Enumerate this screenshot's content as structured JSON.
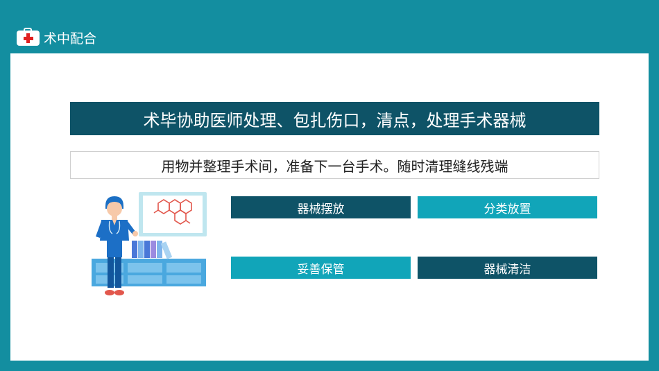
{
  "header": {
    "title": "术中配合",
    "icon": "medical-kit-icon"
  },
  "content": {
    "title": "术毕协助医师处理、包扎伤口，清点，处理手术器械",
    "subtitle": "用物并整理手术间，准备下一台手术。随时清理缝线残端",
    "tags": [
      {
        "label": "器械摆放",
        "style": "dark"
      },
      {
        "label": "分类放置",
        "style": "light"
      },
      {
        "label": "妥善保管",
        "style": "light"
      },
      {
        "label": "器械清洁",
        "style": "dark"
      }
    ]
  },
  "colors": {
    "background": "#138ea0",
    "dark_teal": "#0e5367",
    "light_teal": "#11a5b9",
    "cross_red": "#e02020"
  }
}
